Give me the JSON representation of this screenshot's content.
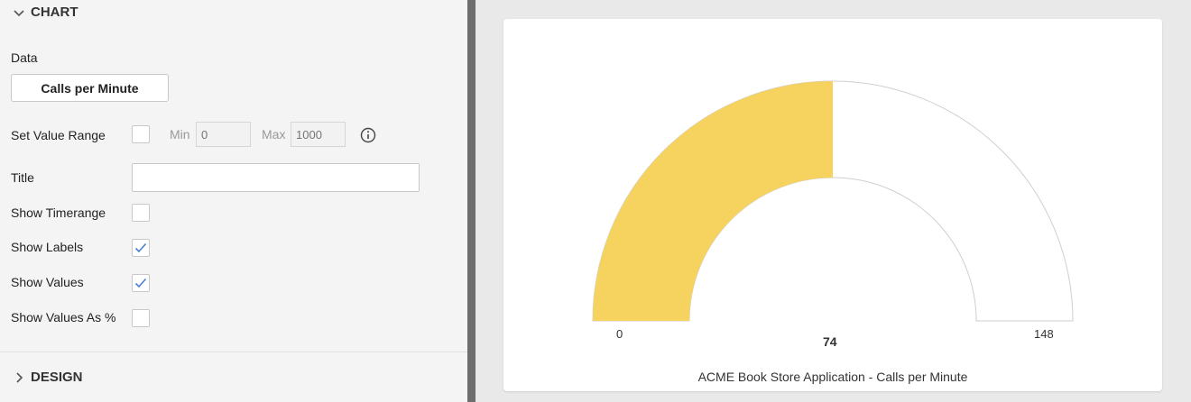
{
  "chart_section": {
    "title": "CHART",
    "expanded": true
  },
  "data_field": {
    "label": "Data",
    "button": "Calls per Minute"
  },
  "value_range": {
    "label": "Set Value Range",
    "checked": false,
    "min_label": "Min",
    "min_placeholder": "0",
    "max_label": "Max",
    "max_placeholder": "1000",
    "info_icon": "info-icon"
  },
  "title_field": {
    "label": "Title",
    "value": ""
  },
  "options": [
    {
      "label": "Show Timerange",
      "checked": false
    },
    {
      "label": "Show Labels",
      "checked": true
    },
    {
      "label": "Show Values",
      "checked": true
    },
    {
      "label": "Show Values As %",
      "checked": false
    }
  ],
  "design_section": {
    "title": "DESIGN",
    "expanded": false
  },
  "colors": {
    "gauge_fill": "#f6d35f",
    "checkmark": "#4a7fd0",
    "divider": "#6e6e6e"
  },
  "chart_data": {
    "type": "gauge",
    "min": 0,
    "max": 148,
    "value": 74,
    "min_label": "0",
    "max_label": "148",
    "value_label": "74",
    "caption": "ACME Book Store Application - Calls per Minute"
  }
}
